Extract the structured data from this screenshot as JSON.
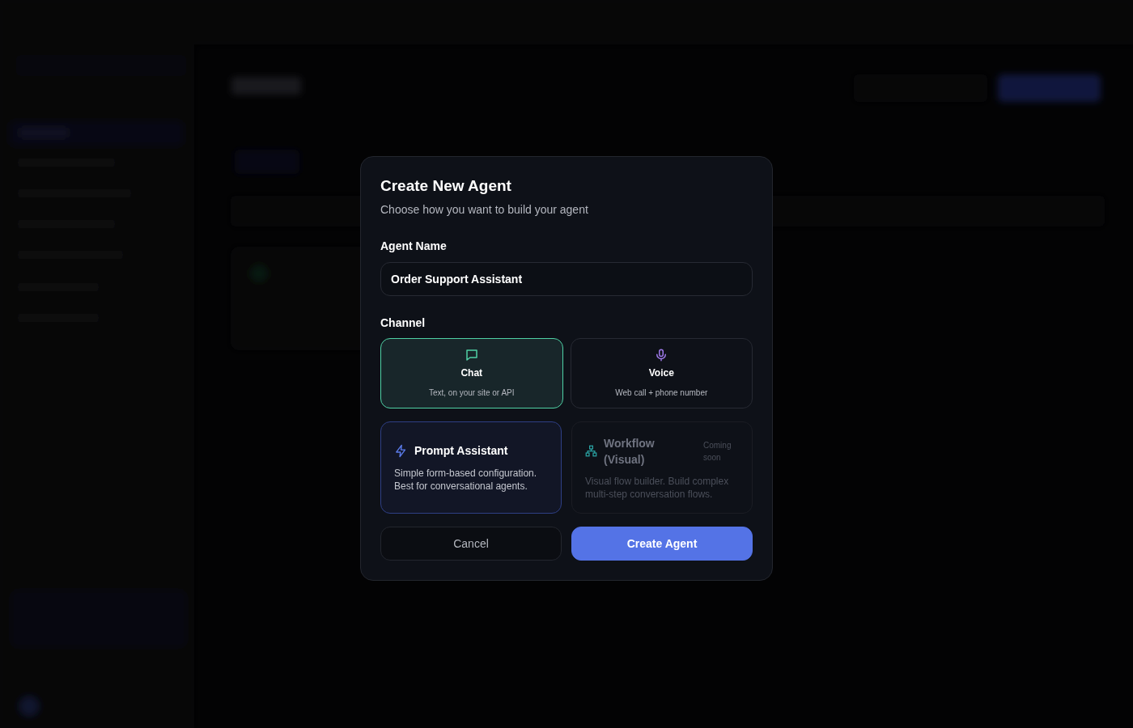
{
  "dialog": {
    "title": "Create New Agent",
    "subtitle": "Choose how you want to build your agent",
    "name_label": "Agent Name",
    "name_value": "Order Support Assistant",
    "channel_label": "Channel",
    "channels": [
      {
        "kind": "chat",
        "label": "Chat",
        "description": "Text, on your site or API",
        "selected": true
      },
      {
        "kind": "voice",
        "label": "Voice",
        "description": "Web call + phone number",
        "selected": false
      }
    ],
    "builders": [
      {
        "kind": "prompt",
        "label": "Prompt Assistant",
        "description": "Simple form-based configuration. Best for conversational agents.",
        "selected": true,
        "disabled": false
      },
      {
        "kind": "workflow",
        "label": "Workflow (Visual)",
        "badge": "Coming soon",
        "description": "Visual flow builder. Build complex multi-step conversation flows.",
        "selected": false,
        "disabled": true
      }
    ],
    "buttons": [
      {
        "kind": "secondary",
        "label": "Cancel"
      },
      {
        "kind": "primary",
        "label": "Create Agent"
      }
    ]
  }
}
